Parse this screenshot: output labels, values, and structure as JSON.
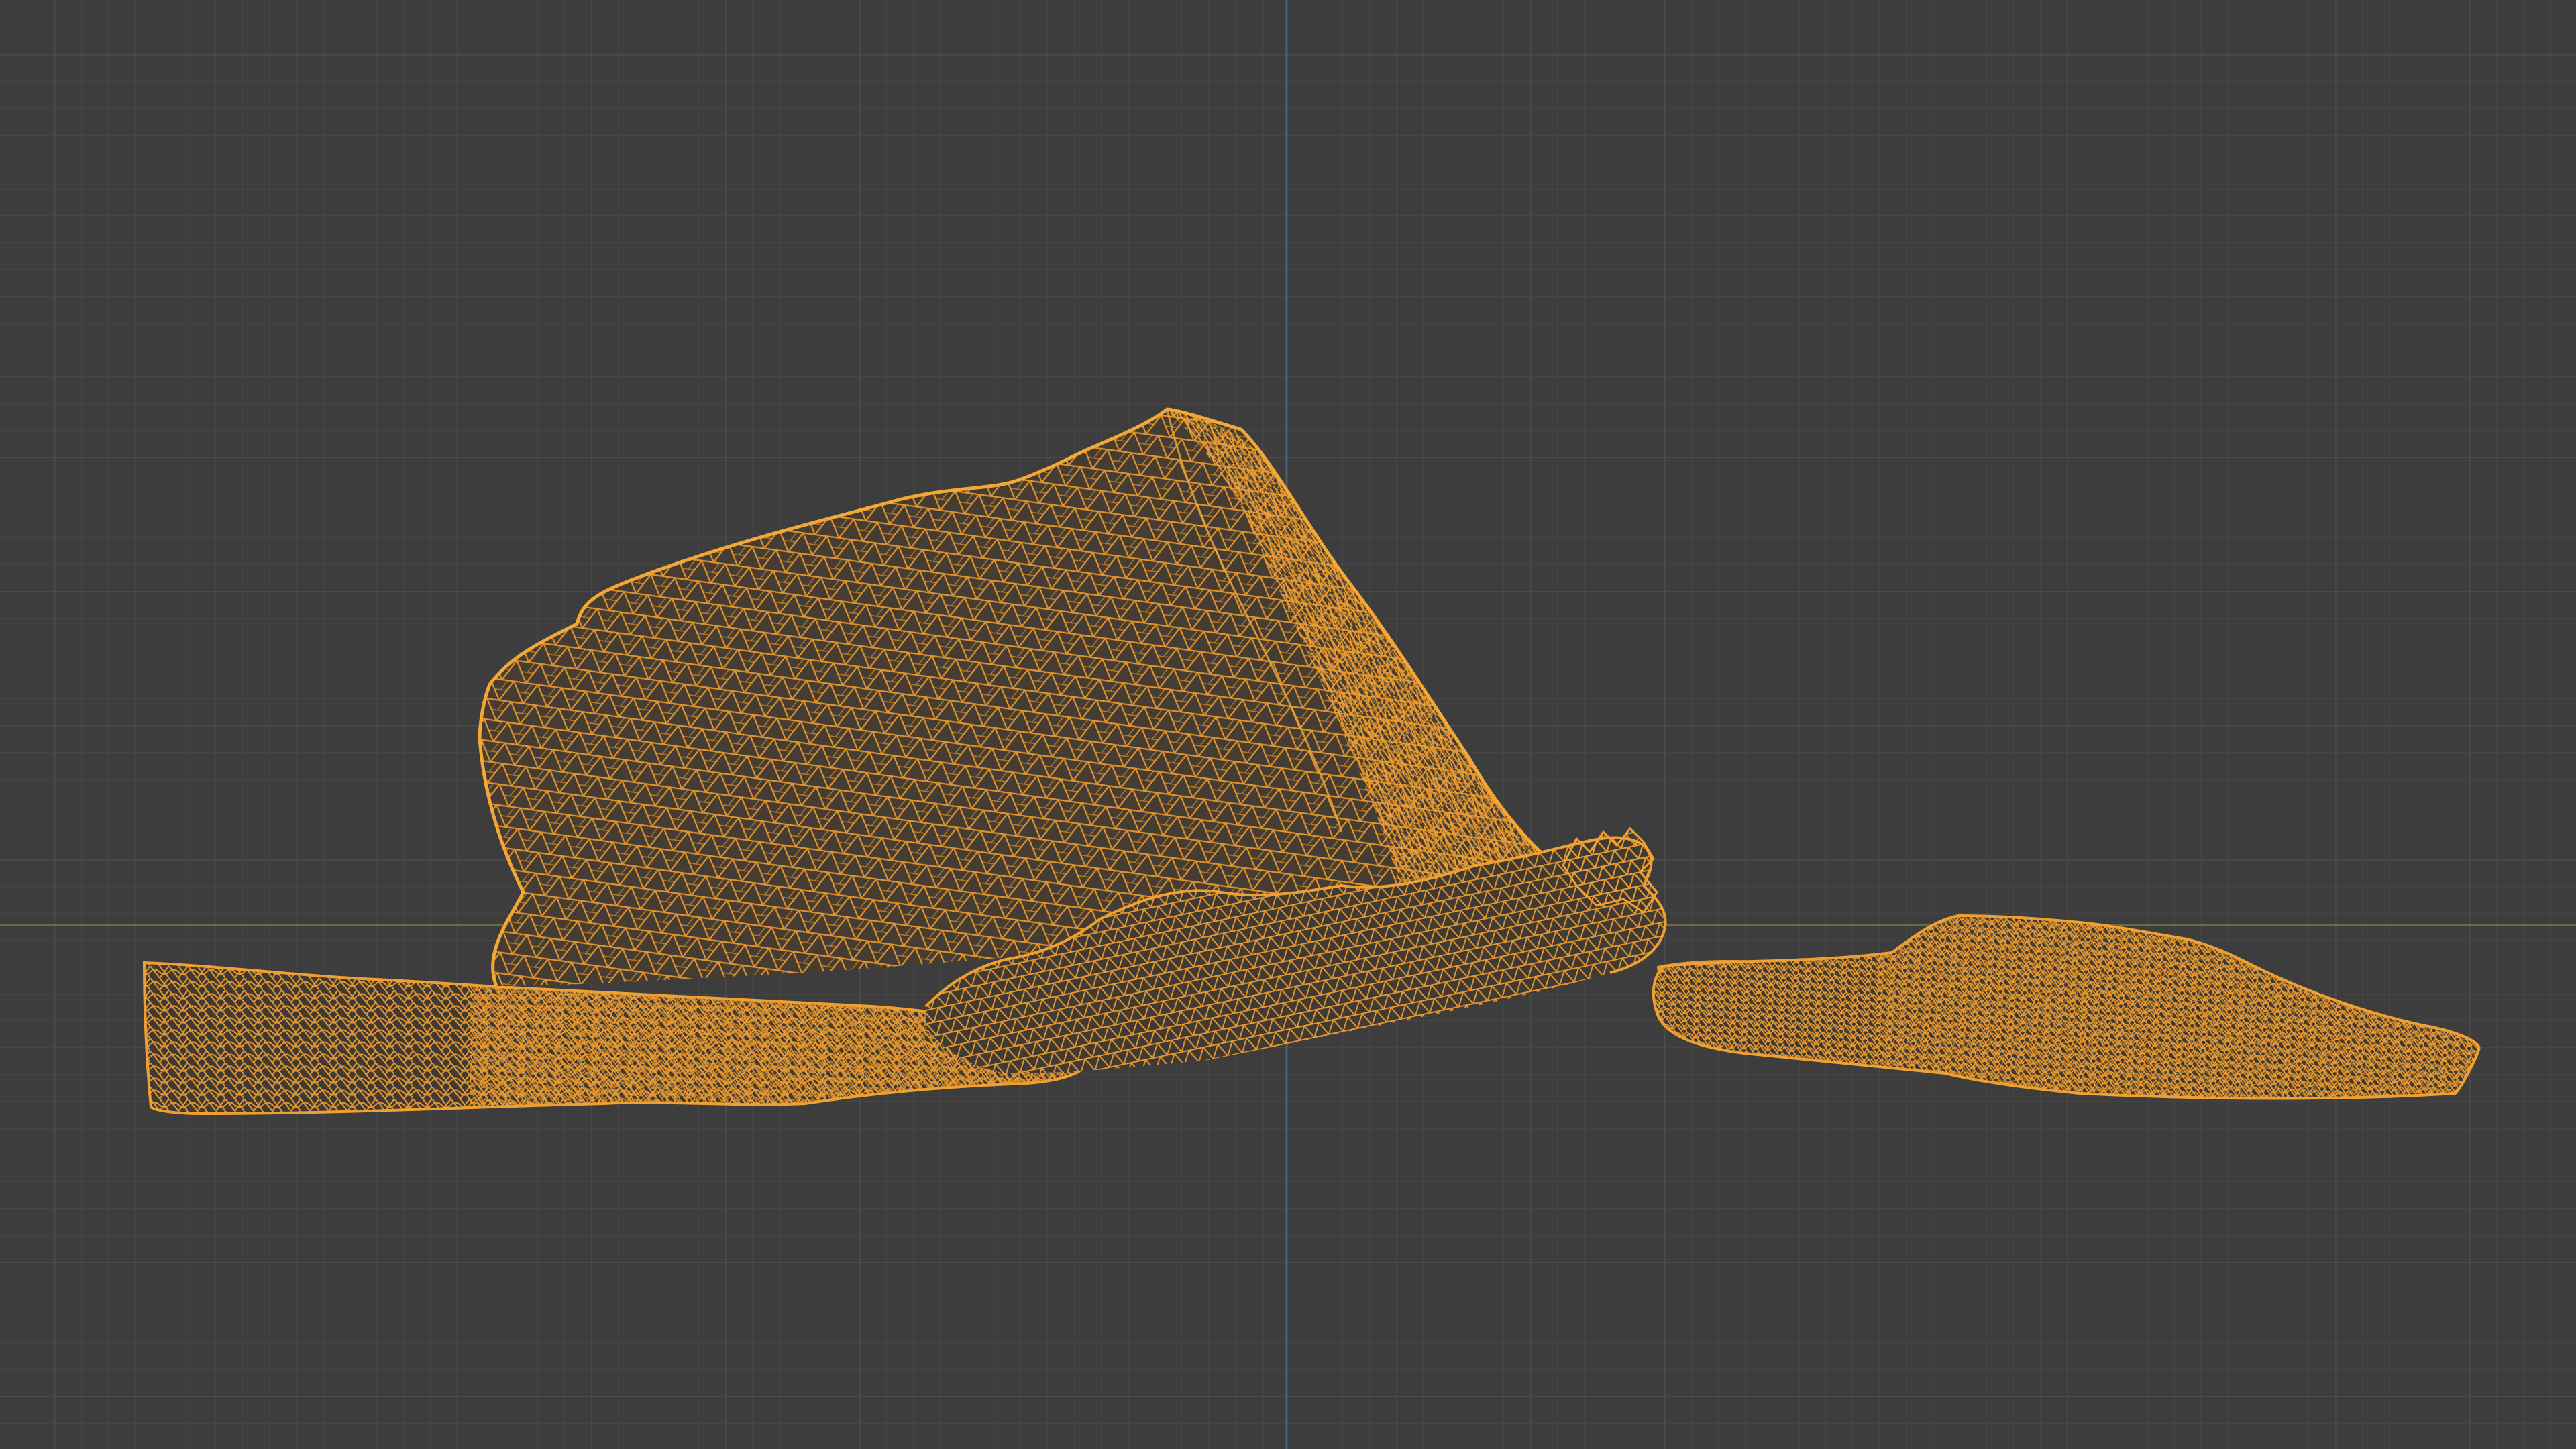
{
  "viewport": {
    "view": "3D Viewport",
    "shading": "wireframe",
    "object": "scanned-rock-and-ground-mesh",
    "colors": {
      "background": "#3d3d3d",
      "grid_minor": "#474747",
      "grid_major": "#505050",
      "x_axis": "#6f6b3c",
      "z_axis": "#46607a",
      "wire_selected": "#f0a030",
      "wire_dense": "#e8962a"
    },
    "grid_visible": true
  }
}
